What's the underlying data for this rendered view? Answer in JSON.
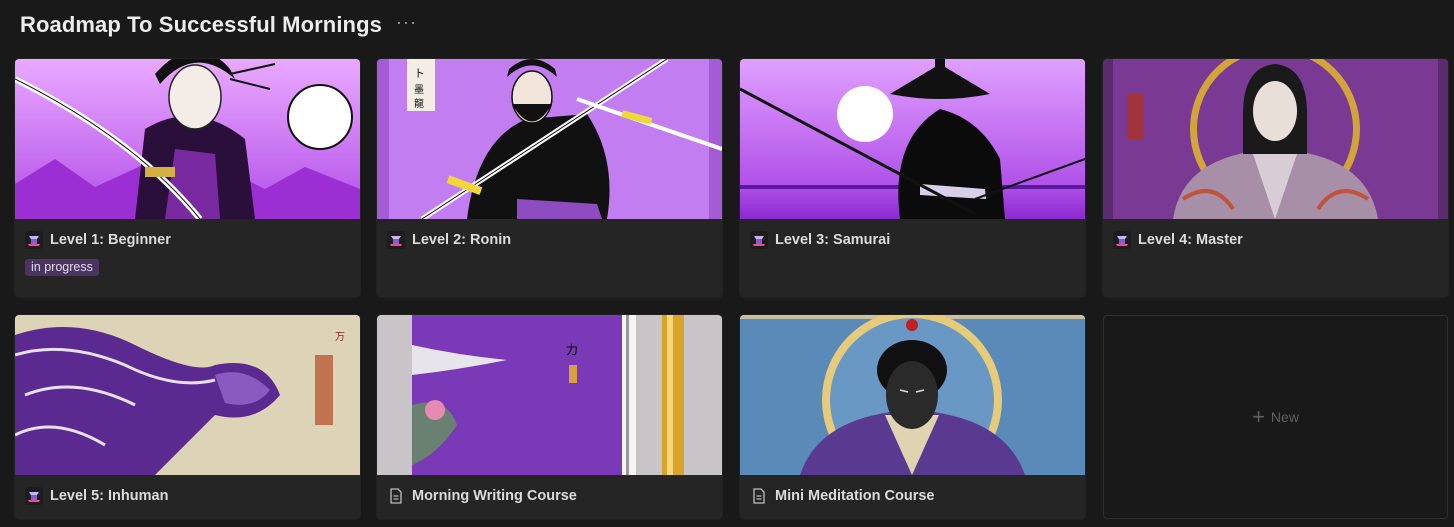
{
  "page": {
    "title": "Roadmap To Successful Mornings",
    "more_label": "···"
  },
  "cards": [
    {
      "title": "Level 1: Beginner",
      "icon": "samurai-emoji-icon",
      "tag": "in progress"
    },
    {
      "title": "Level 2: Ronin",
      "icon": "samurai-emoji-icon"
    },
    {
      "title": "Level 3: Samurai",
      "icon": "samurai-emoji-icon"
    },
    {
      "title": "Level 4: Master",
      "icon": "samurai-emoji-icon"
    },
    {
      "title": "Level 5: Inhuman",
      "icon": "samurai-emoji-icon"
    },
    {
      "title": "Morning Writing Course",
      "icon": "document-icon"
    },
    {
      "title": "Mini Meditation Course",
      "icon": "document-icon"
    }
  ],
  "new_card": {
    "label": "New",
    "plus": "+"
  },
  "colors": {
    "background": "#191919",
    "card": "#252525",
    "tag_bg": "#4a3560",
    "accent_purple": "#9b3fd6"
  }
}
